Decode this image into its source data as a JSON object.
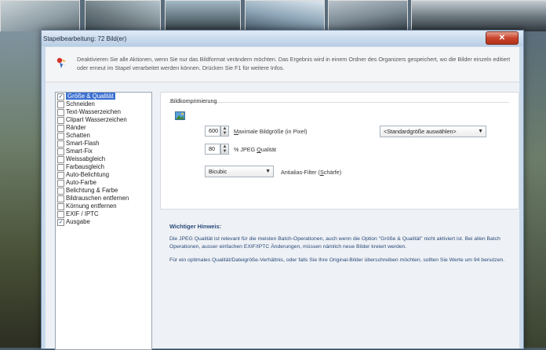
{
  "window": {
    "title": "Stapelbearbeitung: 72 Bild(er)",
    "close_glyph": "✕"
  },
  "info": {
    "icon": "info-arrow-icon",
    "text": "Deaktivieren Sie alle Aktionen, wenn Sie nur das Bildformat verändern möchten. Das Ergebnis wird in einem Ordner des Organizers gespeichert, wo die Bilder einzeln editiert oder erneut im Stapel verarbeitet werden können. Drücken Sie F1 für weitere Infos."
  },
  "actions": [
    {
      "label": "Größe & Qualität",
      "checked": true,
      "selected": true
    },
    {
      "label": "Schneiden",
      "checked": false,
      "selected": false
    },
    {
      "label": "Text-Wasserzeichen",
      "checked": false,
      "selected": false
    },
    {
      "label": "Clipart Wasserzeichen",
      "checked": false,
      "selected": false
    },
    {
      "label": "Ränder",
      "checked": false,
      "selected": false
    },
    {
      "label": "Schatten",
      "checked": false,
      "selected": false
    },
    {
      "label": "Smart-Flash",
      "checked": false,
      "selected": false
    },
    {
      "label": "Smart-Fix",
      "checked": false,
      "selected": false
    },
    {
      "label": "Weissabgleich",
      "checked": false,
      "selected": false
    },
    {
      "label": "Farbausgleich",
      "checked": false,
      "selected": false
    },
    {
      "label": "Auto-Belichtung",
      "checked": false,
      "selected": false
    },
    {
      "label": "Auto-Farbe",
      "checked": false,
      "selected": false
    },
    {
      "label": "Belichtung & Farbe",
      "checked": false,
      "selected": false
    },
    {
      "label": "Bildrauschen entfernen",
      "checked": false,
      "selected": false
    },
    {
      "label": "Körnung entfernen",
      "checked": false,
      "selected": false
    },
    {
      "label": "EXIF / IPTC",
      "checked": false,
      "selected": false
    },
    {
      "label": "Ausgabe",
      "checked": true,
      "selected": false
    }
  ],
  "compression": {
    "group_title": "Bildkomprimierung",
    "max_size_value": "600",
    "max_size_label_prefix": "M",
    "max_size_label_rest": "aximale Bildgröße (in Pixel)",
    "size_preset": "<Standardgröße auswählen>",
    "quality_value": "80",
    "quality_label_prefix": "% JPEG ",
    "quality_label_underlined": "Q",
    "quality_label_rest": "ualität",
    "filter_value": "Bicubic",
    "filter_label_prefix": "Antialias-Filter (",
    "filter_label_underlined": "S",
    "filter_label_rest": "chärfe)"
  },
  "notes": {
    "heading": "Wichtiger Hinweis:",
    "paragraph1": "Die JPEG Qualität ist relevant für die meisten Batch-Operationen, auch wenn die Option \"Größe & Qualität\" nicht aktiviert ist. Bei allen Batch Operationen, ausser einfachen EXIF/IPTC Änderungen, müssen nämlich neue Bilder kreiert werden.",
    "paragraph2": "Für ein optimales Qualität/Dateigröße-Verhältnis, oder falls Sie Ihre Original-Bilder überschreiben möchten, sollten Sie Werte um 94 benutzen."
  },
  "colors": {
    "selection": "#3a6fd0",
    "close": "#c9442c",
    "note_text": "#2a4a7a"
  }
}
